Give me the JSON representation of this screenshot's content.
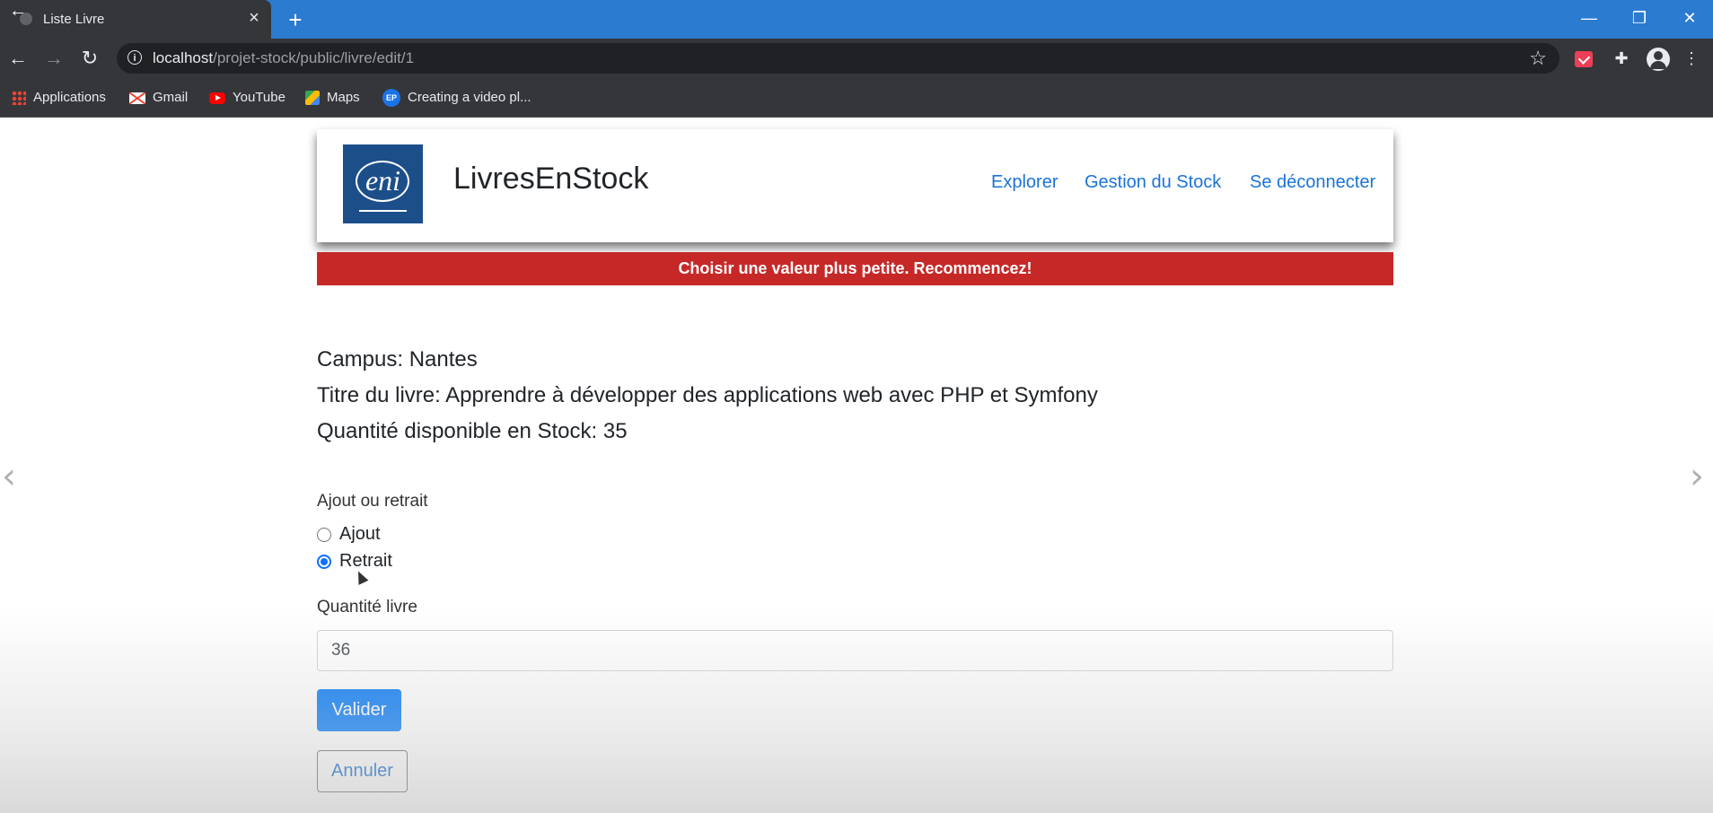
{
  "browser": {
    "tab": {
      "title": "Liste Livre"
    },
    "url": {
      "host": "localhost",
      "path": "/projet-stock/public/livre/edit/1"
    },
    "bookmarks": [
      {
        "label": "Applications",
        "icon": "apps-grid-icon"
      },
      {
        "label": "Gmail",
        "icon": "gmail-icon"
      },
      {
        "label": "YouTube",
        "icon": "youtube-icon"
      },
      {
        "label": "Maps",
        "icon": "maps-icon"
      },
      {
        "label": "Creating a video pl...",
        "icon": "ep-icon",
        "icon_text": "EP"
      }
    ]
  },
  "header": {
    "logo_text": "eni",
    "brand": "LivresEnStock",
    "nav": [
      {
        "label": "Explorer"
      },
      {
        "label": "Gestion du Stock"
      },
      {
        "label": "Se déconnecter"
      }
    ]
  },
  "alert": {
    "message": "Choisir une valeur plus petite. Recommencez!",
    "color": "#c62828"
  },
  "info": {
    "campus": "Campus: Nantes",
    "title": "Titre du livre: Apprendre à développer des applications web avec PHP et Symfony",
    "stock": "Quantité disponible en Stock: 35"
  },
  "form": {
    "operation_label": "Ajout ou retrait",
    "options": [
      {
        "label": "Ajout",
        "checked": false
      },
      {
        "label": "Retrait",
        "checked": true
      }
    ],
    "quantity_label": "Quantité livre",
    "quantity_value": "36",
    "submit_label": "Valider",
    "cancel_label": "Annuler"
  },
  "colors": {
    "accent": "#0d7ff8",
    "link": "#1a73d6",
    "tabbar": "#2b7bd1"
  }
}
